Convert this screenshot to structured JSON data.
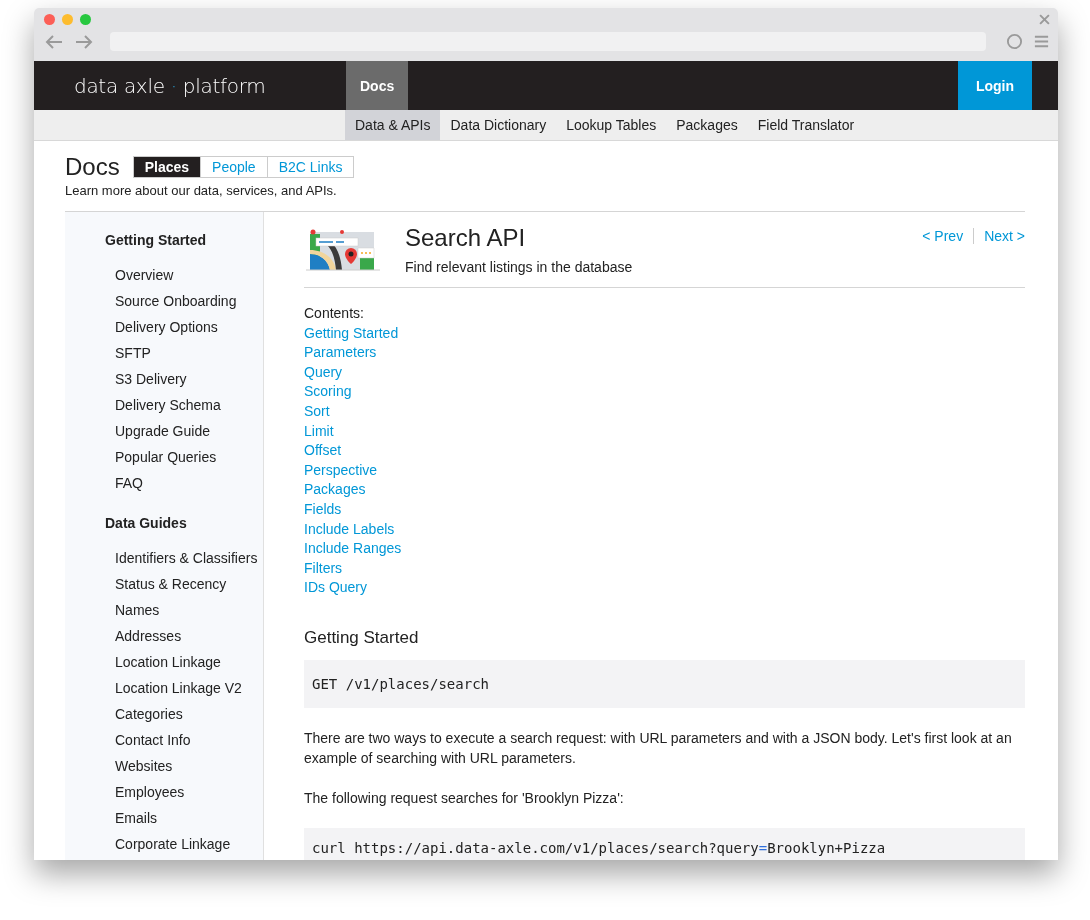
{
  "logo": {
    "brand": "data axle",
    "separator": "·",
    "product": "platform"
  },
  "top_nav": [
    {
      "label": "Docs",
      "selected": true
    }
  ],
  "login": "Login",
  "sub_nav": [
    {
      "label": "Data & APIs",
      "selected": true
    },
    {
      "label": "Data Dictionary",
      "selected": false
    },
    {
      "label": "Lookup Tables",
      "selected": false
    },
    {
      "label": "Packages",
      "selected": false
    },
    {
      "label": "Field Translator",
      "selected": false
    }
  ],
  "page": {
    "title": "Docs",
    "subtitle": "Learn more about our data, services, and APIs.",
    "tabs": [
      {
        "label": "Places",
        "selected": true
      },
      {
        "label": "People",
        "selected": false
      },
      {
        "label": "B2C Links",
        "selected": false
      }
    ]
  },
  "sidebar": [
    {
      "heading": "Getting Started",
      "items": [
        "Overview",
        "Source Onboarding",
        "Delivery Options",
        "SFTP",
        "S3 Delivery",
        "Delivery Schema",
        "Upgrade Guide",
        "Popular Queries",
        "FAQ"
      ]
    },
    {
      "heading": "Data Guides",
      "items": [
        "Identifiers & Classifiers",
        "Status & Recency",
        "Names",
        "Addresses",
        "Location Linkage",
        "Location Linkage V2",
        "Categories",
        "Contact Info",
        "Websites",
        "Employees",
        "Emails",
        "Corporate Linkage"
      ]
    }
  ],
  "article": {
    "title": "Search API",
    "subtitle": "Find relevant listings in the database",
    "prev": "< Prev",
    "next": "Next >",
    "contents_label": "Contents:",
    "contents": [
      "Getting Started",
      "Parameters",
      "Query",
      "Scoring",
      "Sort",
      "Limit",
      "Offset",
      "Perspective",
      "Packages",
      "Fields",
      "Include Labels",
      "Include Ranges",
      "Filters",
      "IDs Query"
    ],
    "section_title": "Getting Started",
    "code_1": "GET /v1/places/search",
    "paragraph_1": "There are two ways to execute a search request: with URL parameters and with a JSON body. Let's first look at an example of searching with URL parameters.",
    "paragraph_2": "The following request searches for 'Brooklyn Pizza':",
    "code_2": [
      {
        "text": "curl https://api.data-axle.com/v1/places/search?query",
        "kind": "plain"
      },
      {
        "text": "=",
        "kind": "operator"
      },
      {
        "text": "Brooklyn+Pizza",
        "kind": "plain"
      }
    ]
  }
}
